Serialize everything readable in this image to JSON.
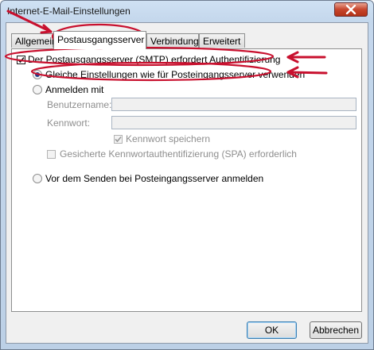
{
  "window": {
    "title": "Internet-E-Mail-Einstellungen"
  },
  "tabs": [
    {
      "label": "Allgemein",
      "active": false
    },
    {
      "label": "Postausgangsserver",
      "active": true
    },
    {
      "label": "Verbindung",
      "active": false
    },
    {
      "label": "Erweitert",
      "active": false
    }
  ],
  "outgoing": {
    "requires_auth_label": "Der Postausgangsserver (SMTP) erfordert Authentifizierung",
    "requires_auth_checked": true,
    "same_settings_label": "Gleiche Einstellungen wie für Posteingangsserver verwenden",
    "same_settings_selected": true,
    "logon_with_label": "Anmelden mit",
    "username_label": "Benutzername:",
    "username_value": "",
    "password_label": "Kennwort:",
    "password_value": "",
    "remember_password_label": "Kennwort speichern",
    "remember_password_checked": true,
    "spa_label": "Gesicherte Kennwortauthentifizierung (SPA) erforderlich",
    "spa_checked": false,
    "pop_before_smtp_label": "Vor dem Senden bei Posteingangsserver anmelden"
  },
  "buttons": {
    "ok": "OK",
    "cancel": "Abbrechen"
  },
  "colors": {
    "annotation_red": "#c8102e",
    "window_frame": "#c4d7ec",
    "close_button": "#c7452c"
  },
  "icons": {
    "close": "close-icon",
    "checkmark": "checkmark-icon",
    "arrow": "arrow-annotation"
  }
}
